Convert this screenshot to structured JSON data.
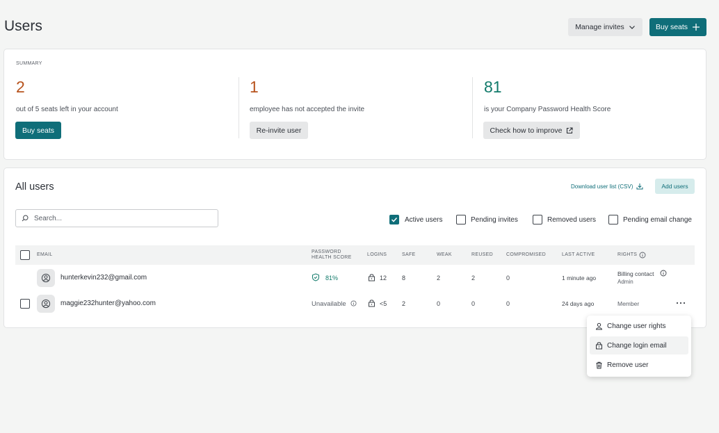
{
  "page": {
    "title": "Users"
  },
  "header": {
    "manage_invites_label": "Manage invites",
    "buy_seats_label": "Buy seats"
  },
  "summary": {
    "label": "SUMMARY",
    "seats": {
      "value": "2",
      "text": "out of 5 seats left in your account",
      "button": "Buy seats"
    },
    "invites": {
      "value": "1",
      "text": "employee has not accepted the invite",
      "button": "Re-invite user"
    },
    "health": {
      "value": "81",
      "text": "is your Company Password Health Score",
      "button": "Check how to improve"
    }
  },
  "users_section": {
    "title": "All users",
    "download_label": "Download user list (CSV)",
    "add_users_label": "Add users",
    "search_placeholder": "Search...",
    "filters": [
      {
        "label": "Active users",
        "checked": true
      },
      {
        "label": "Pending invites",
        "checked": false
      },
      {
        "label": "Removed users",
        "checked": false
      },
      {
        "label": "Pending email change",
        "checked": false
      }
    ]
  },
  "table": {
    "headers": {
      "email": "EMAIL",
      "health_1": "PASSWORD",
      "health_2": "HEALTH SCORE",
      "logins": "LOGINS",
      "safe": "SAFE",
      "weak": "WEAK",
      "reused": "REUSED",
      "compromised": "COMPROMISED",
      "last_active": "LAST ACTIVE",
      "rights": "RIGHTS"
    },
    "rows": [
      {
        "email": "hunterkevin232@gmail.com",
        "health": "81%",
        "logins": "12",
        "safe": "8",
        "weak": "2",
        "reused": "2",
        "compromised": "0",
        "last_active": "1 minute ago",
        "rights": "Billing contact",
        "rights_sub": "Admin"
      },
      {
        "email": "maggie232hunter@yahoo.com",
        "health": "Unavailable",
        "logins": "<5",
        "safe": "2",
        "weak": "0",
        "reused": "0",
        "compromised": "0",
        "last_active": "24 days ago",
        "rights": "Member"
      }
    ]
  },
  "context_menu": {
    "items": [
      {
        "label": "Change user rights",
        "icon": "user-icon"
      },
      {
        "label": "Change login email",
        "icon": "lock-icon"
      },
      {
        "label": "Remove user",
        "icon": "trash-icon"
      }
    ]
  },
  "colors": {
    "accent": "#0f6e79",
    "orange": "#b7531d",
    "green": "#117a6a"
  }
}
